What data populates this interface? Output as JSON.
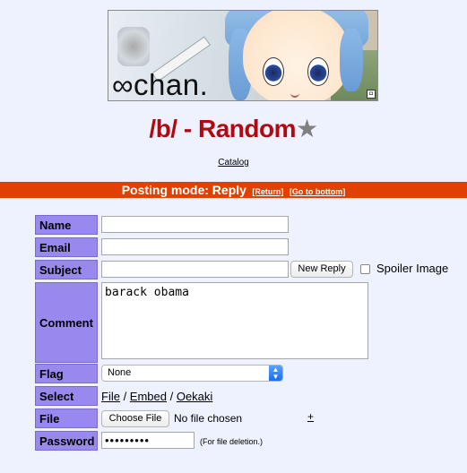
{
  "banner": {
    "logo_text": "∞chan."
  },
  "board": {
    "title": "/b/ - Random",
    "star": "★"
  },
  "nav": {
    "catalog_label": "Catalog"
  },
  "mode_bar": {
    "title": "Posting mode: Reply",
    "return_label": "[Return]",
    "bottom_label": "[Go to bottom]"
  },
  "form": {
    "name_label": "Name",
    "email_label": "Email",
    "subject_label": "Subject",
    "comment_label": "Comment",
    "flag_label": "Flag",
    "select_label": "Select",
    "file_label": "File",
    "password_label": "Password",
    "name_value": "",
    "email_value": "",
    "subject_value": "",
    "new_reply_button": "New Reply",
    "spoiler_label": "Spoiler Image",
    "comment_value": "barack obama",
    "flag_value": "None",
    "select_file": "File",
    "select_sep1": " / ",
    "select_embed": "Embed",
    "select_sep2": " / ",
    "select_oekaki": "Oekaki",
    "choose_file_button": "Choose File",
    "no_file_text": "No file chosen",
    "add_file": "+",
    "password_value": "•••••••••",
    "password_hint": "(For file deletion.)"
  },
  "colors": {
    "title": "#af0a0f",
    "mode_bar_bg": "#e04000",
    "label_bg": "#9988ee",
    "page_bg": "#eef2ff"
  }
}
